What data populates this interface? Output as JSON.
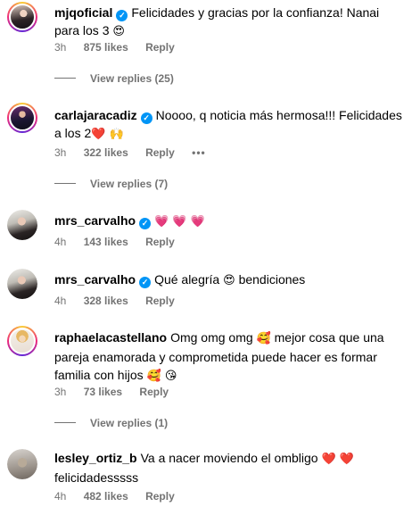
{
  "comments": [
    {
      "username": "mjqoficial",
      "verified": true,
      "text": "Felicidades y gracias por la confianza! Nanai para los 3 ",
      "emoji": "😍",
      "time": "3h",
      "likes": "875 likes",
      "reply": "Reply",
      "view_replies": "View replies (25)"
    },
    {
      "username": "carlajaracadiz",
      "verified": true,
      "text": "Noooo, q noticia más hermosa!!! Felicidades a los 2",
      "emoji": "❤️ 🙌",
      "time": "3h",
      "likes": "322 likes",
      "reply": "Reply",
      "more": "•••",
      "view_replies": "View replies (7)"
    },
    {
      "username": "mrs_carvalho",
      "verified": true,
      "text": "",
      "emoji": "💗 💗 💗",
      "time": "4h",
      "likes": "143 likes",
      "reply": "Reply"
    },
    {
      "username": "mrs_carvalho",
      "verified": true,
      "text": "Qué alegría ",
      "emoji": "😍",
      "text2": "  bendiciones",
      "time": "4h",
      "likes": "328 likes",
      "reply": "Reply"
    },
    {
      "username": "raphaelacastellano",
      "verified": false,
      "text": "Omg omg omg ",
      "emoji": "🥰",
      "text2": "  mejor cosa que una pareja enamorada y comprometida puede hacer es formar familia con hijos ",
      "emoji2": "🥰 😘",
      "time": "3h",
      "likes": "73 likes",
      "reply": "Reply",
      "view_replies": "View replies (1)"
    },
    {
      "username": "lesley_ortiz_b",
      "verified": false,
      "text": "Va a nacer moviendo el ombligo ",
      "emoji": "❤️ ❤️",
      "text2": " felicidadesssss",
      "time": "4h",
      "likes": "482 likes",
      "reply": "Reply"
    }
  ],
  "verified_icon": "check-badge",
  "accent_verified": "#0095f6"
}
